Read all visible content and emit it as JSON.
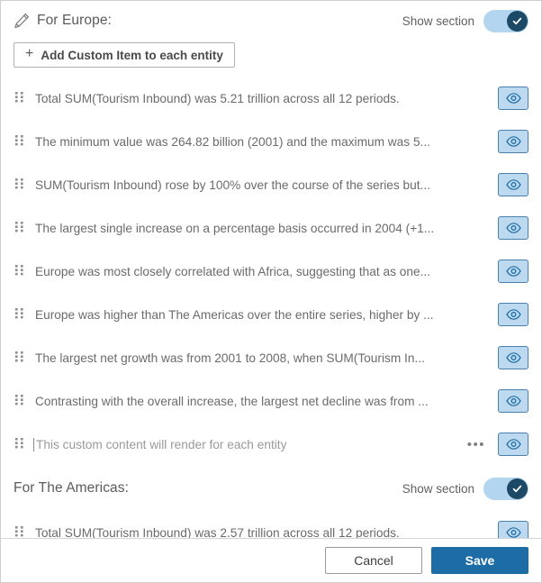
{
  "dialog": {
    "accent_color": "#1e6ca5",
    "toggle_track_color": "#b3d5ef",
    "toggle_knob_color": "#1c4966",
    "eye_button_bg": "#bcd9f0",
    "eye_button_border": "#4a80ad"
  },
  "sections": [
    {
      "edit_icon": "pencil-icon",
      "title": "For Europe:",
      "show_section_label": "Show section",
      "toggle_on": true,
      "add_button": {
        "icon": "plus-icon",
        "label": "Add Custom Item to each entity"
      },
      "items": [
        {
          "handle_icon": "drag-handle-icon",
          "text": "Total SUM(Tourism Inbound) was 5.21 trillion across all 12 periods.",
          "visibility_icon": "eye-icon",
          "has_kebab": false,
          "is_placeholder": false
        },
        {
          "handle_icon": "drag-handle-icon",
          "text": "The minimum value was 264.82 billion (2001) and the maximum was 5...",
          "visibility_icon": "eye-icon",
          "has_kebab": false,
          "is_placeholder": false
        },
        {
          "handle_icon": "drag-handle-icon",
          "text": "SUM(Tourism Inbound) rose by 100% over the course of the series but...",
          "visibility_icon": "eye-icon",
          "has_kebab": false,
          "is_placeholder": false
        },
        {
          "handle_icon": "drag-handle-icon",
          "text": "The largest single increase on a percentage basis occurred in 2004 (+1...",
          "visibility_icon": "eye-icon",
          "has_kebab": false,
          "is_placeholder": false
        },
        {
          "handle_icon": "drag-handle-icon",
          "text": "Europe was most closely correlated with Africa, suggesting that as one...",
          "visibility_icon": "eye-icon",
          "has_kebab": false,
          "is_placeholder": false
        },
        {
          "handle_icon": "drag-handle-icon",
          "text": "Europe was higher than The Americas over the entire series, higher by ...",
          "visibility_icon": "eye-icon",
          "has_kebab": false,
          "is_placeholder": false
        },
        {
          "handle_icon": "drag-handle-icon",
          "text": "The largest net growth was from 2001 to 2008, when SUM(Tourism In...",
          "visibility_icon": "eye-icon",
          "has_kebab": false,
          "is_placeholder": false
        },
        {
          "handle_icon": "drag-handle-icon",
          "text": "Contrasting with the overall increase, the largest net decline was from ...",
          "visibility_icon": "eye-icon",
          "has_kebab": false,
          "is_placeholder": false
        },
        {
          "handle_icon": "drag-handle-icon",
          "text": "This custom content will render for each entity",
          "visibility_icon": "eye-icon",
          "kebab_label": "•••",
          "has_kebab": true,
          "is_placeholder": true
        }
      ]
    },
    {
      "edit_icon": "",
      "title": "For The Americas:",
      "show_section_label": "Show section",
      "toggle_on": true,
      "items": [
        {
          "handle_icon": "drag-handle-icon",
          "text": "Total SUM(Tourism Inbound) was 2.57 trillion across all 12 periods.",
          "visibility_icon": "eye-icon",
          "has_kebab": false,
          "is_placeholder": false
        }
      ]
    }
  ],
  "footer": {
    "cancel_label": "Cancel",
    "save_label": "Save"
  }
}
